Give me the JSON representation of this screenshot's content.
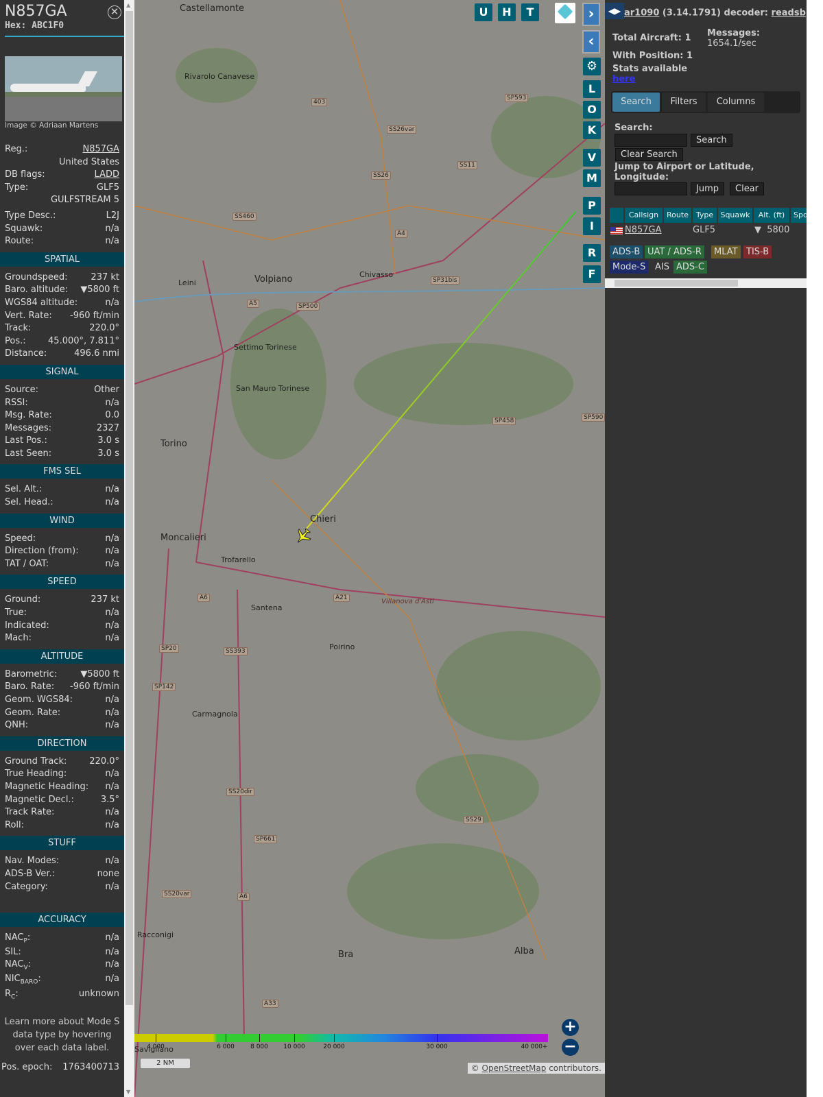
{
  "aircraft": {
    "title": "N857GA",
    "hex": "Hex: ABC1F0",
    "photo_credit": "Image © Adriaan Martens"
  },
  "info": [
    {
      "label": "Reg.:",
      "value": "N857GA",
      "link": true
    },
    {
      "label": "",
      "value": "United States"
    },
    {
      "label": "DB flags:",
      "value": "LADD",
      "link": true
    },
    {
      "label": "Type:",
      "value": "GLF5"
    },
    {
      "label": "",
      "value": "GULFSTREAM 5"
    }
  ],
  "info2": [
    {
      "label": "Type Desc.:",
      "value": "L2J"
    },
    {
      "label": "Squawk:",
      "value": "n/a"
    },
    {
      "label": "Route:",
      "value": "n/a"
    }
  ],
  "sections": [
    {
      "title": "SPATIAL",
      "rows": [
        {
          "label": "Groundspeed:",
          "value": "237 kt"
        },
        {
          "label": "Baro. altitude:",
          "value": "▼5800 ft"
        },
        {
          "label": "WGS84 altitude:",
          "value": "n/a"
        },
        {
          "label": "Vert. Rate:",
          "value": "-960 ft/min"
        },
        {
          "label": "Track:",
          "value": "220.0°"
        },
        {
          "label": "Pos.:",
          "value": "45.000°, 7.811°"
        },
        {
          "label": "Distance:",
          "value": "496.6 nmi"
        }
      ]
    },
    {
      "title": "SIGNAL",
      "rows": [
        {
          "label": "Source:",
          "value": "Other"
        },
        {
          "label": "RSSI:",
          "value": "n/a"
        },
        {
          "label": "Msg. Rate:",
          "value": "0.0"
        },
        {
          "label": "Messages:",
          "value": "2327"
        },
        {
          "label": "Last Pos.:",
          "value": "3.0 s"
        },
        {
          "label": "Last Seen:",
          "value": "3.0 s"
        }
      ]
    },
    {
      "title": "FMS SEL",
      "rows": [
        {
          "label": "Sel. Alt.:",
          "value": "n/a"
        },
        {
          "label": "Sel. Head.:",
          "value": "n/a"
        }
      ]
    },
    {
      "title": "WIND",
      "rows": [
        {
          "label": "Speed:",
          "value": "n/a"
        },
        {
          "label": "Direction (from):",
          "value": "n/a"
        },
        {
          "label": "TAT / OAT:",
          "value": "n/a"
        }
      ]
    },
    {
      "title": "SPEED",
      "rows": [
        {
          "label": "Ground:",
          "value": "237 kt"
        },
        {
          "label": "True:",
          "value": "n/a"
        },
        {
          "label": "Indicated:",
          "value": "n/a"
        },
        {
          "label": "Mach:",
          "value": "n/a"
        }
      ]
    },
    {
      "title": "ALTITUDE",
      "rows": [
        {
          "label": "Barometric:",
          "value": "▼5800 ft"
        },
        {
          "label": "Baro. Rate:",
          "value": "-960 ft/min"
        },
        {
          "label": "Geom. WGS84:",
          "value": "n/a"
        },
        {
          "label": "Geom. Rate:",
          "value": "n/a"
        },
        {
          "label": "QNH:",
          "value": "n/a"
        }
      ]
    },
    {
      "title": "DIRECTION",
      "rows": [
        {
          "label": "Ground Track:",
          "value": "220.0°"
        },
        {
          "label": "True Heading:",
          "value": "n/a"
        },
        {
          "label": "Magnetic Heading:",
          "value": "n/a"
        },
        {
          "label": "Magnetic Decl.:",
          "value": "3.5°"
        },
        {
          "label": "Track Rate:",
          "value": "n/a"
        },
        {
          "label": "Roll:",
          "value": "n/a"
        }
      ]
    },
    {
      "title": "STUFF",
      "rows": [
        {
          "label": "Nav. Modes:",
          "value": "n/a"
        },
        {
          "label": "ADS-B Ver.:",
          "value": "none"
        },
        {
          "label": "Category:",
          "value": "n/a"
        }
      ]
    }
  ],
  "accuracy": {
    "title": "ACCURACY",
    "nacp": "NAC",
    "nacp_sub": "P",
    "sil": "SIL:",
    "nacv": "NAC",
    "nacv_sub": "V",
    "nic": "NIC",
    "nic_sub": "BARO",
    "rc": "R",
    "rc_sub": "C",
    "na": "n/a",
    "unknown": "unknown"
  },
  "note": "Learn more about Mode S data type by hovering over each data label.",
  "epoch": {
    "label": "Pos. epoch:",
    "value": "1763400713"
  },
  "map": {
    "buttons": [
      "U",
      "H",
      "T"
    ],
    "side_buttons": [
      "L",
      "O",
      "K",
      "V",
      "M",
      "P",
      "I",
      "R",
      "F"
    ],
    "places": [
      "Castellamonte",
      "Rivarolo Canavese",
      "Volpiano",
      "Leini",
      "Chivasso",
      "Settimo Torinese",
      "San Mauro Torinese",
      "Torino",
      "Chieri",
      "Moncalieri",
      "Trofarello",
      "Santena",
      "Poirino",
      "Carmagnola",
      "Racconigi",
      "Bra",
      "Alba",
      "Savigliano",
      "Villanova d'Asti"
    ],
    "roads": [
      "SS26var",
      "SS26",
      "SS11",
      "SP593",
      "SS460",
      "A4",
      "SP31bis",
      "A5",
      "SP500",
      "SP458",
      "SP590",
      "A6",
      "A21",
      "SP20",
      "SS393",
      "SP142",
      "SS20dir",
      "SP661",
      "SS29",
      "SS20var",
      "A6",
      "A33",
      "403"
    ],
    "legend_ticks": [
      "4 000",
      "6 000",
      "8 000",
      "10 000",
      "20 000",
      "30 000",
      "40 000+"
    ],
    "scale": "2 NM",
    "attribution_prefix": "© ",
    "attribution_link": "OpenStreetMap",
    "attribution_suffix": " contributors."
  },
  "header": {
    "app": "ar1090",
    "version": "(3.14.1791)",
    "decoder_label": "decoder:",
    "decoder": "readsb"
  },
  "stats": {
    "total": "Total Aircraft: 1",
    "messages_label": "Messages:",
    "messages": "1654.1/sec",
    "with_pos": "With Position: 1",
    "stats_avail": "Stats available",
    "here": "here"
  },
  "tabs": [
    "Search",
    "Filters",
    "Columns"
  ],
  "search": {
    "label": "Search:",
    "search_btn": "Search",
    "clear_btn": "Clear Search",
    "jump_label": "Jump to Airport or Latitude, Longitude:",
    "jump_btn": "Jump",
    "clear2_btn": "Clear"
  },
  "table": {
    "headers": [
      "Callsign",
      "Route",
      "Type",
      "Squawk",
      "Alt. (ft)",
      "Spd"
    ],
    "row": {
      "callsign": "N857GA",
      "route": "",
      "type": "GLF5",
      "squawk": "",
      "alt": "▼  5800"
    }
  },
  "badges": [
    {
      "t": "ADS-B",
      "c": "#1d4f6a"
    },
    {
      "t": "UAT / ADS-R",
      "c": "#2a6a3a"
    },
    {
      "t": "MLAT",
      "c": "#6a5a2a"
    },
    {
      "t": "TIS-B",
      "c": "#7a2a2a"
    },
    {
      "t": "Mode-S",
      "c": "#1c2a6a"
    },
    {
      "t": "AIS",
      "c": "#333"
    },
    {
      "t": "ADS-C",
      "c": "#2a6a3a"
    }
  ]
}
